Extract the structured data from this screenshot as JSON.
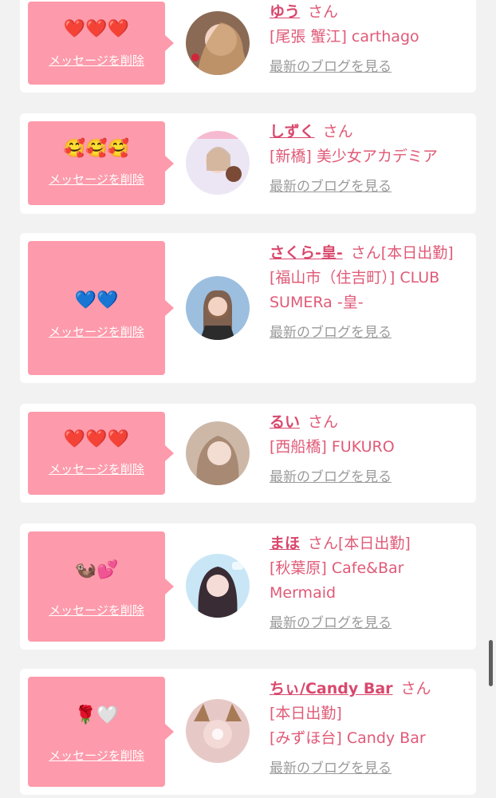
{
  "delete_label": "メッセージを削除",
  "blog_label": "最新のブログを見る",
  "cards": [
    {
      "emoji": "❤️❤️❤️",
      "name": "ゆう",
      "san": "さん",
      "shop": "[尾張 蟹江] carthago",
      "avatar_icon": "avatar-photo"
    },
    {
      "emoji": "🥰🥰🥰",
      "name": "しずく",
      "san": "さん",
      "shop": "[新橋] 美少女アカデミア",
      "avatar_icon": "avatar-photo"
    },
    {
      "emoji": "💙💙",
      "name": "さくら-皇-",
      "san": "さん[本日出勤]",
      "shop": "[福山市（住吉町）] CLUB SUMERa -皇-",
      "avatar_icon": "avatar-photo"
    },
    {
      "emoji": "❤️❤️❤️",
      "name": "るい",
      "san": "さん",
      "shop": "[西船橋] FUKURO",
      "avatar_icon": "avatar-photo"
    },
    {
      "emoji": "🦦💕",
      "name": "まほ",
      "san": "さん[本日出勤]",
      "shop": "[秋葉原] Cafe&Bar Mermaid",
      "avatar_icon": "avatar-photo"
    },
    {
      "emoji": "🌹🤍",
      "name": "ちぃ/Candy Bar",
      "san": "さん",
      "status": "[本日出勤]",
      "shop": "[みずほ台] Candy Bar",
      "avatar_icon": "avatar-photo"
    }
  ],
  "colors": {
    "bubble": "#fd9aab",
    "name": "#d9486d",
    "text": "#e05a77",
    "link_gray": "#9b9b9b",
    "page_bg": "#f2f2f2"
  }
}
